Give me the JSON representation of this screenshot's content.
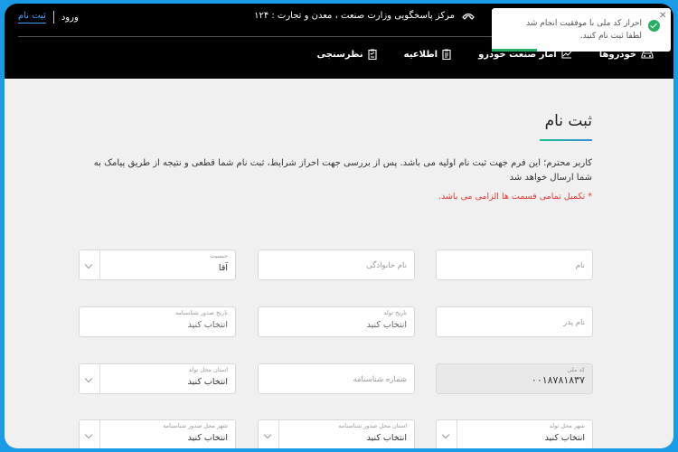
{
  "header": {
    "brand_text": "مرکز پاسخگویی وزارت صنعت ، معدن و تجارت : ۱۲۴",
    "login_label": "ورود",
    "signup_label": "ثبت نام",
    "nav": [
      {
        "label": "خودروها",
        "icon": "car-icon"
      },
      {
        "label": "آمار صنعت خودرو",
        "icon": "chart-line-icon"
      },
      {
        "label": "اطلاعیه",
        "icon": "clipboard-icon"
      },
      {
        "label": "نظرسنجی",
        "icon": "survey-icon"
      }
    ]
  },
  "toast": {
    "line1": "احراز کد ملی با موفقیت انجام شد",
    "line2": "لطفا ثبت نام کنید.",
    "close": "✕",
    "progress": 0.25,
    "color": "#27ae60"
  },
  "main": {
    "title": "ثبت نام",
    "description": "کاربر محترم؛ این فرم جهت ثبت نام اولیه می باشد. پس از بررسی جهت احراز شرایط، ثبت نام شما قطعی و نتیجه از طریق پیامک به شما ارسال خواهد شد",
    "required_note": "* تکمیل تمامی قسمت ها الزامی می باشد."
  },
  "form": {
    "first_name": {
      "placeholder": "نام"
    },
    "last_name": {
      "placeholder": "نام خانوادگی"
    },
    "gender": {
      "label": "جنسیت",
      "value": "آقا"
    },
    "father_name": {
      "placeholder": "نام پدر"
    },
    "birth_date": {
      "label": "تاریخ تولد",
      "value": "انتخاب کنید"
    },
    "id_issue_date": {
      "label": "تاریخ صدور شناسنامه",
      "value": "انتخاب کنید"
    },
    "national_code": {
      "label": "کد ملی",
      "value": "۰۰۱۸۷۸۱۸۳۷"
    },
    "id_number": {
      "placeholder": "شماره شناسنامه"
    },
    "birth_province": {
      "label": "استان محل تولد",
      "value": "انتخاب کنید"
    },
    "birth_city": {
      "label": "شهر محل تولد",
      "value": "انتخاب کنید"
    },
    "issue_province": {
      "label": "استان محل صدور شناسنامه",
      "value": "انتخاب کنید"
    },
    "issue_city": {
      "label": "شهر محل صدور شناسنامه",
      "value": "انتخاب کنید"
    }
  },
  "colors": {
    "accent": "#3aa0ff",
    "success": "#27ae60",
    "error": "#e53935",
    "frame": "#1a9be6"
  }
}
